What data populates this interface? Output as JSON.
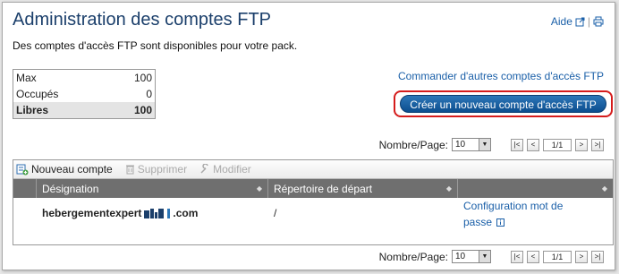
{
  "header": {
    "title": "Administration des comptes FTP",
    "help_label": "Aide",
    "description": "Des comptes d'accès FTP sont disponibles pour votre pack."
  },
  "stats": {
    "rows": [
      {
        "label": "Max",
        "value": "100"
      },
      {
        "label": "Occupés",
        "value": "0"
      },
      {
        "label": "Libres",
        "value": "100"
      }
    ]
  },
  "actions": {
    "order_link": "Commander d'autres comptes d'accès FTP",
    "create_button": "Créer un nouveau compte d'accès FTP"
  },
  "pager": {
    "label": "Nombre/Page:",
    "page_size": "10",
    "page_display": "1/1",
    "first": "|<",
    "prev": "<",
    "next": ">",
    "last": ">|"
  },
  "toolbar": {
    "new_label": "Nouveau compte",
    "delete_label": "Supprimer",
    "edit_label": "Modifier"
  },
  "table": {
    "columns": [
      "Désignation",
      "Répertoire de départ",
      ""
    ],
    "rows": [
      {
        "domain_prefix": "hebergementexpert",
        "domain_suffix": ".com",
        "directory": "/",
        "config_link": "Configuration mot de passe"
      }
    ]
  },
  "colors": {
    "accent": "#1a5fa8",
    "title": "#1b3f6b",
    "highlight": "#d51c1c"
  }
}
